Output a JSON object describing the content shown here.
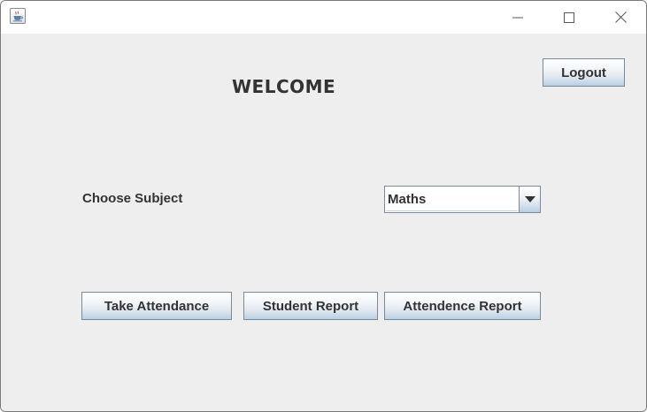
{
  "window": {
    "title": "",
    "controls": {
      "minimize_icon": "minimize-icon",
      "maximize_icon": "maximize-icon",
      "close_icon": "close-icon"
    },
    "app_icon": "java-cup-icon"
  },
  "main": {
    "heading": "WELCOME",
    "logout_label": "Logout",
    "subject_label": "Choose Subject",
    "subject_select": {
      "selected": "Maths",
      "arrow_icon": "dropdown-arrow-icon"
    },
    "actions": {
      "take_attendance_label": "Take Attendance",
      "student_report_label": "Student Report",
      "attendance_report_label": "Attendence Report"
    }
  },
  "colors": {
    "content_bg": "#eeeeee",
    "titlebar_bg": "#ffffff",
    "text": "#333333",
    "button_border": "#7a8a99",
    "button_gradient_bottom": "#b8cfe5"
  }
}
